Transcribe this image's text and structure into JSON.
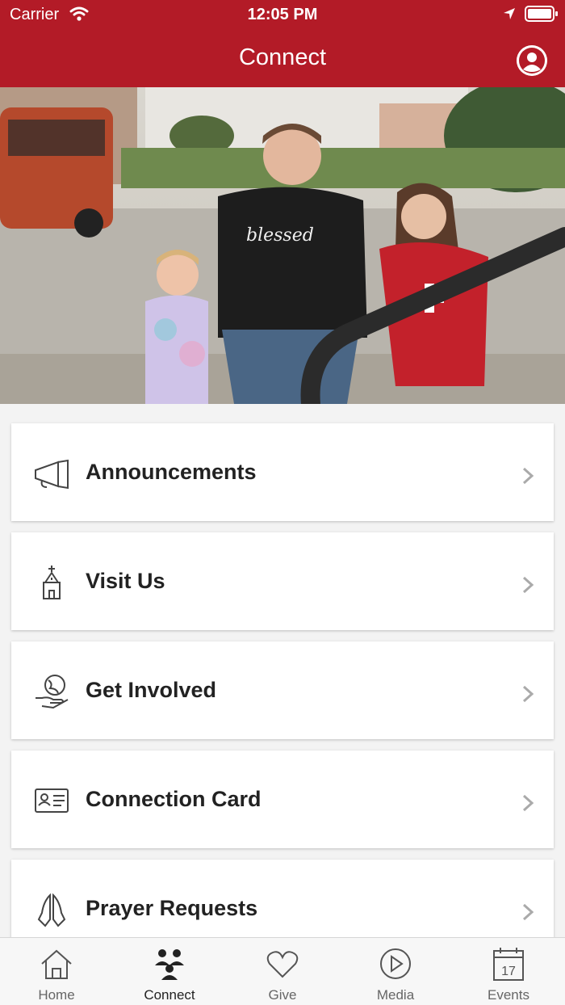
{
  "status_bar": {
    "carrier": "Carrier",
    "time": "12:05 PM"
  },
  "header": {
    "title": "Connect"
  },
  "hero": {
    "shirt_text": "blessed"
  },
  "menu": [
    {
      "label": "Announcements",
      "icon": "megaphone-icon"
    },
    {
      "label": "Visit Us",
      "icon": "church-icon"
    },
    {
      "label": "Get Involved",
      "icon": "globe-hand-icon"
    },
    {
      "label": "Connection Card",
      "icon": "id-card-icon"
    },
    {
      "label": "Prayer Requests",
      "icon": "praying-hands-icon"
    }
  ],
  "tabs": [
    {
      "label": "Home",
      "icon": "home-icon"
    },
    {
      "label": "Connect",
      "icon": "people-icon",
      "active": true
    },
    {
      "label": "Give",
      "icon": "heart-icon"
    },
    {
      "label": "Media",
      "icon": "play-icon"
    },
    {
      "label": "Events",
      "icon": "calendar-icon",
      "date": "17"
    }
  ],
  "colors": {
    "brand": "#b31b27",
    "background": "#f3f3f3",
    "card": "#ffffff"
  }
}
